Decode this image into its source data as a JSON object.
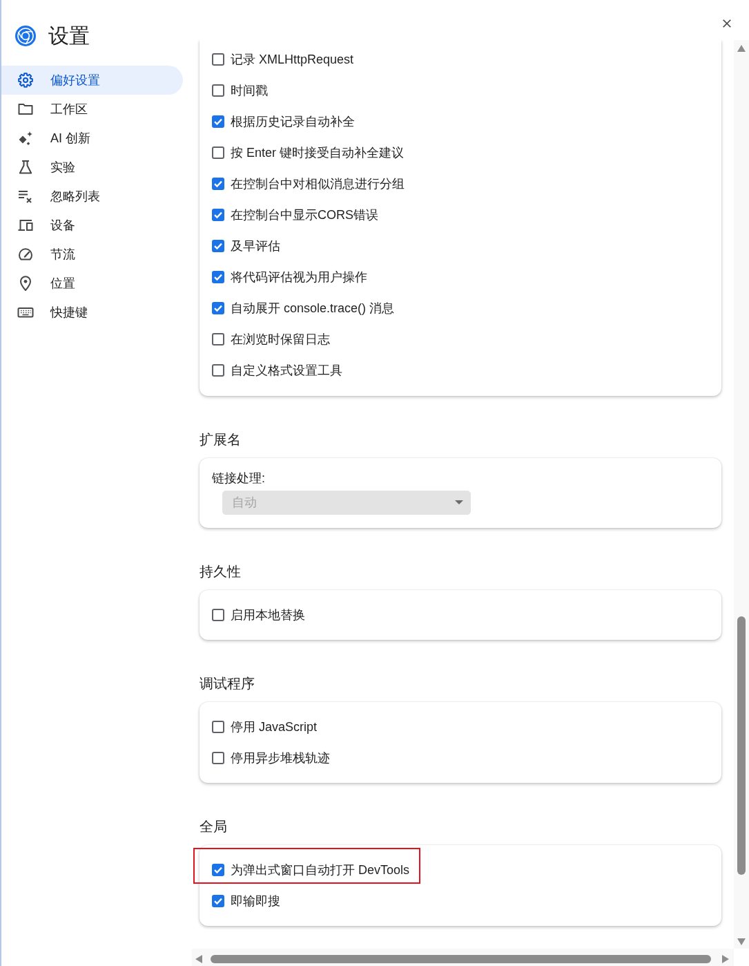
{
  "header": {
    "title": "设置"
  },
  "sidebar": {
    "items": [
      {
        "label": "偏好设置",
        "selected": true
      },
      {
        "label": "工作区",
        "selected": false
      },
      {
        "label": "AI 创新",
        "selected": false
      },
      {
        "label": "实验",
        "selected": false
      },
      {
        "label": "忽略列表",
        "selected": false
      },
      {
        "label": "设备",
        "selected": false
      },
      {
        "label": "节流",
        "selected": false
      },
      {
        "label": "位置",
        "selected": false
      },
      {
        "label": "快捷键",
        "selected": false
      }
    ]
  },
  "sections": [
    {
      "kind": "checklist",
      "items": [
        {
          "label": "记录 XMLHttpRequest",
          "checked": false
        },
        {
          "label": "时间戳",
          "checked": false
        },
        {
          "label": "根据历史记录自动补全",
          "checked": true
        },
        {
          "label": "按 Enter 键时接受自动补全建议",
          "checked": false
        },
        {
          "label": "在控制台中对相似消息进行分组",
          "checked": true
        },
        {
          "label": "在控制台中显示CORS错误",
          "checked": true
        },
        {
          "label": "及早评估",
          "checked": true
        },
        {
          "label": "将代码评估视为用户操作",
          "checked": true
        },
        {
          "label": "自动展开 console.trace() 消息",
          "checked": true
        },
        {
          "label": "在浏览时保留日志",
          "checked": false
        },
        {
          "label": "自定义格式设置工具",
          "checked": false
        }
      ]
    },
    {
      "kind": "dropdown",
      "heading": "扩展名",
      "field_label": "链接处理:",
      "select": {
        "value": "自动",
        "disabled": true
      }
    },
    {
      "kind": "checklist",
      "heading": "持久性",
      "items": [
        {
          "label": "启用本地替换",
          "checked": false
        }
      ]
    },
    {
      "kind": "checklist",
      "heading": "调试程序",
      "items": [
        {
          "label": "停用 JavaScript",
          "checked": false
        },
        {
          "label": "停用异步堆栈轨迹",
          "checked": false
        }
      ]
    },
    {
      "kind": "checklist",
      "heading": "全局",
      "items": [
        {
          "label": "为弹出式窗口自动打开 DevTools",
          "checked": true,
          "highlighted": true
        },
        {
          "label": "即输即搜",
          "checked": true,
          "highlighted": false
        }
      ]
    }
  ]
}
